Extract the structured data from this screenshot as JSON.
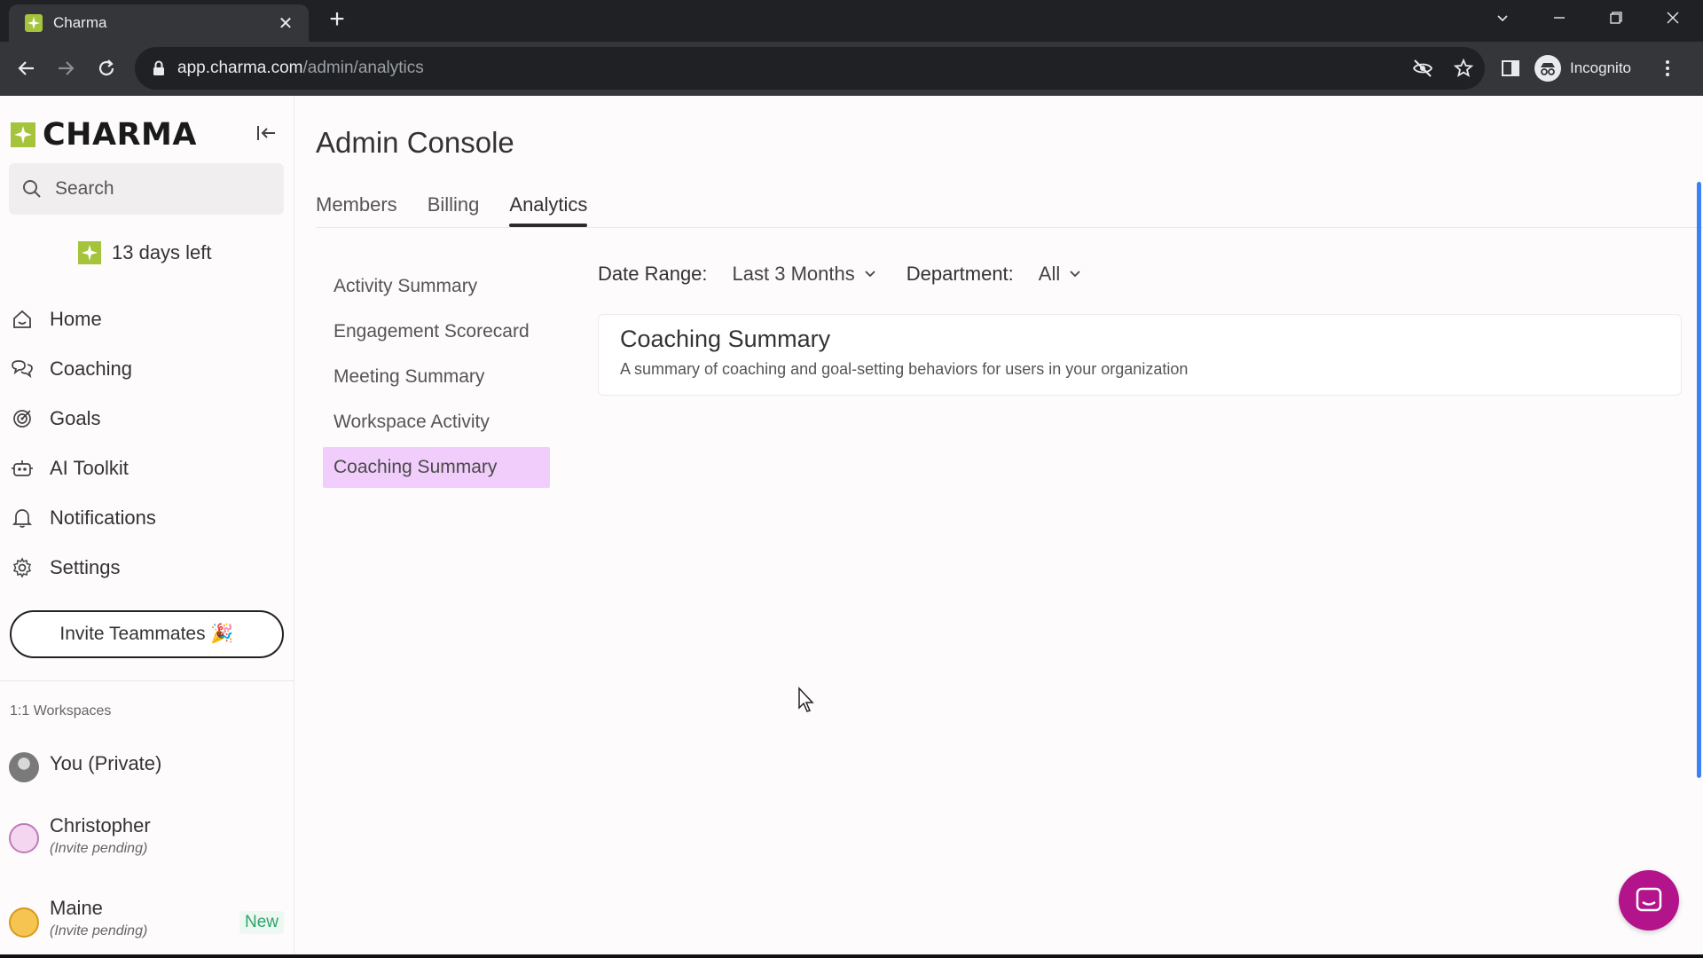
{
  "browser": {
    "tab_title": "Charma",
    "url_host": "app.charma.com",
    "url_path": "/admin/analytics",
    "profile_label": "Incognito"
  },
  "sidebar": {
    "logo_text": "CHARMA",
    "search_placeholder": "Search",
    "trial_text": "13 days left",
    "nav_items": [
      {
        "label": "Home",
        "icon": "home-icon"
      },
      {
        "label": "Coaching",
        "icon": "coaching-icon"
      },
      {
        "label": "Goals",
        "icon": "target-icon"
      },
      {
        "label": "AI Toolkit",
        "icon": "robot-icon"
      },
      {
        "label": "Notifications",
        "icon": "bell-icon"
      },
      {
        "label": "Settings",
        "icon": "gear-icon"
      }
    ],
    "invite_label": "Invite Teammates 🎉",
    "workspaces_label": "1:1 Workspaces",
    "workspaces": [
      {
        "name": "You (Private)",
        "sub": ""
      },
      {
        "name": "Christopher",
        "sub": "(Invite pending)"
      },
      {
        "name": "Maine",
        "sub": "(Invite pending)",
        "badge": "New"
      }
    ]
  },
  "main": {
    "title": "Admin Console",
    "tabs": [
      {
        "label": "Members",
        "active": false
      },
      {
        "label": "Billing",
        "active": false
      },
      {
        "label": "Analytics",
        "active": true
      }
    ],
    "subnav": [
      {
        "label": "Activity Summary",
        "active": false
      },
      {
        "label": "Engagement Scorecard",
        "active": false
      },
      {
        "label": "Meeting Summary",
        "active": false
      },
      {
        "label": "Workspace Activity",
        "active": false
      },
      {
        "label": "Coaching Summary",
        "active": true
      }
    ],
    "filters": {
      "date_range_label": "Date Range:",
      "date_range_value": "Last 3 Months",
      "department_label": "Department:",
      "department_value": "All"
    },
    "card": {
      "title": "Coaching Summary",
      "description": "A summary of coaching and goal-setting behaviors for users in your organization"
    }
  },
  "colors": {
    "accent_highlight": "#f0cdfb",
    "brand_star": "#a6c43b",
    "chat_button": "#b3148c",
    "new_badge": "#2fa36b"
  }
}
